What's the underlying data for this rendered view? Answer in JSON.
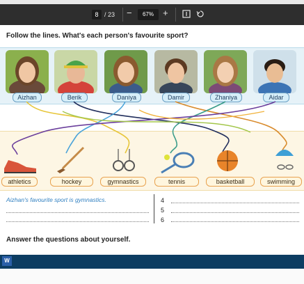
{
  "toolbar": {
    "current_page": "8",
    "page_total": "/ 23",
    "zoom_out": "−",
    "zoom": "67%",
    "zoom_in": "+"
  },
  "exercise": {
    "title": "Follow the lines. What's each person's favourite sport?",
    "people": [
      "Aizhan",
      "Berik",
      "Daniya",
      "Damir",
      "Zhaniya",
      "Aidar"
    ],
    "sports": [
      "athletics",
      "hockey",
      "gymnastics",
      "tennis",
      "basketball",
      "swimming"
    ],
    "example": "Aizhan's favourite sport is gymnastics.",
    "numbers": [
      "4",
      "5",
      "6"
    ],
    "answer_title": "Answer the questions about yourself."
  },
  "colors": {
    "toolbar_bg": "#2e2e2e",
    "photo_band": "#e6f2f8",
    "sport_band": "#fdf6e4",
    "example_blue": "#2f7fc0",
    "taskbar": "#0d3d62"
  },
  "taskbar": {
    "app_icon": "word-icon",
    "app_letter": "W"
  }
}
